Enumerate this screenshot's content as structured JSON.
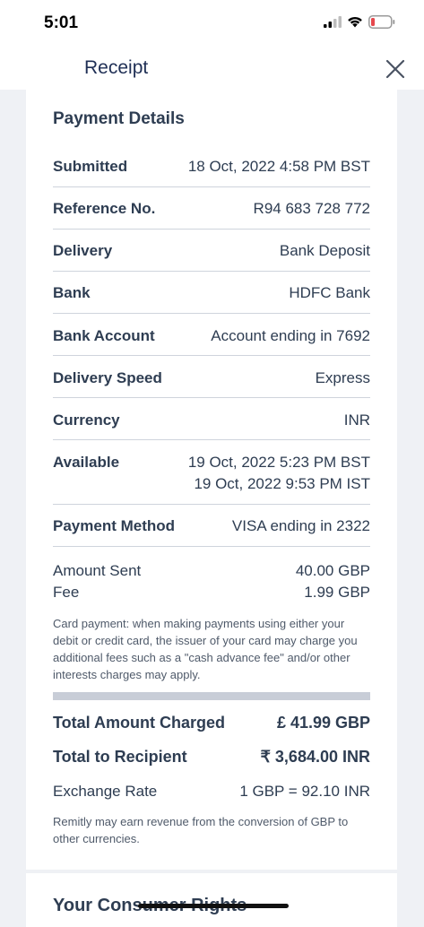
{
  "status": {
    "time": "5:01"
  },
  "header": {
    "title": "Receipt"
  },
  "details": {
    "section_title": "Payment Details",
    "submitted": {
      "label": "Submitted",
      "value": "18 Oct, 2022 4:58 PM BST"
    },
    "reference": {
      "label": "Reference No.",
      "value": "R94 683 728 772"
    },
    "delivery": {
      "label": "Delivery",
      "value": "Bank Deposit"
    },
    "bank": {
      "label": "Bank",
      "value": "HDFC Bank"
    },
    "bank_account": {
      "label": "Bank Account",
      "value": "Account ending in 7692"
    },
    "delivery_speed": {
      "label": "Delivery Speed",
      "value": "Express"
    },
    "currency": {
      "label": "Currency",
      "value": "INR"
    },
    "available": {
      "label": "Available",
      "value_bst": "19 Oct, 2022 5:23 PM BST",
      "value_ist": "19 Oct, 2022 9:53 PM IST"
    },
    "payment_method": {
      "label": "Payment Method",
      "value": "VISA ending in 2322"
    },
    "amount_sent": {
      "label": "Amount Sent",
      "value": "40.00 GBP"
    },
    "fee": {
      "label": "Fee",
      "value": "1.99 GBP"
    },
    "card_note": "Card payment: when making payments using either your debit or credit card, the issuer of your card may charge you additional fees such as a \"cash advance fee\" and/or other interests charges may apply.",
    "total_charged": {
      "label": "Total Amount Charged",
      "value": "£ 41.99 GBP"
    },
    "total_recipient": {
      "label": "Total to Recipient",
      "value": "₹ 3,684.00 INR"
    },
    "exchange_rate": {
      "label": "Exchange Rate",
      "value": "1 GBP = 92.10 INR"
    },
    "fx_note": "Remitly may earn revenue from the conversion of GBP to other currencies."
  },
  "consumer_rights": {
    "title": "Your Consumer Rights"
  },
  "icons": {
    "signal": "signal-icon",
    "wifi": "wifi-icon",
    "battery": "battery-icon",
    "close": "close-icon"
  },
  "colors": {
    "title": "#1f2f55",
    "text": "#2e3d52",
    "battery_low": "#e5484d"
  }
}
